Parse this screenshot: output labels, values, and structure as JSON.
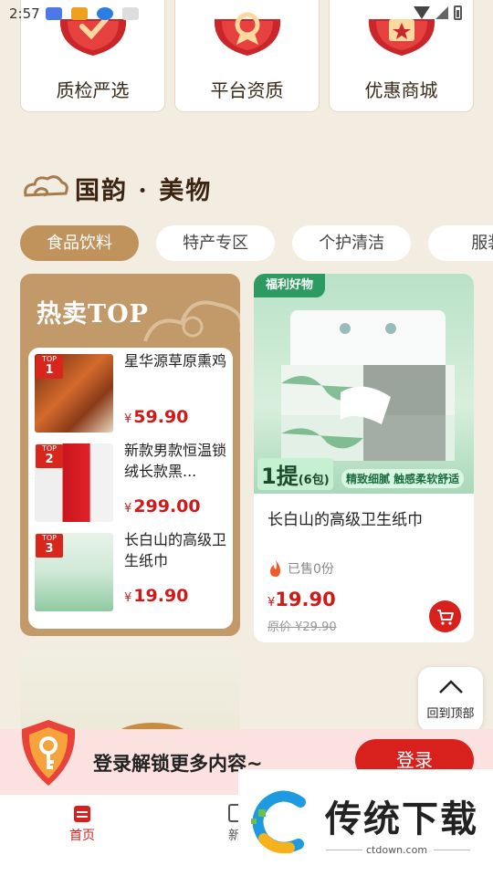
{
  "status_bar": {
    "time": "2:57"
  },
  "top_cards": [
    {
      "label": "质检严选",
      "icon": "quality-check-badge-icon"
    },
    {
      "label": "平台资质",
      "icon": "platform-qualification-badge-icon"
    },
    {
      "label": "优惠商城",
      "icon": "discount-mall-badge-icon"
    }
  ],
  "section": {
    "title": "国韵 · 美物"
  },
  "tabs": [
    {
      "label": "食品饮料",
      "active": true
    },
    {
      "label": "特产专区"
    },
    {
      "label": "个护清洁"
    },
    {
      "label": "服装"
    }
  ],
  "hot": {
    "title": "热卖TOP",
    "items": [
      {
        "rank_top": "TOP",
        "rank": "1",
        "name": "星华源草原熏鸡",
        "yen": "¥",
        "price": "59.90"
      },
      {
        "rank_top": "TOP",
        "rank": "2",
        "name": "新款男款恒温锁绒长款黑...",
        "yen": "¥",
        "price": "299.00"
      },
      {
        "rank_top": "TOP",
        "rank": "3",
        "name": "长白山的高级卫生纸巾",
        "yen": "¥",
        "price": "19.90"
      }
    ]
  },
  "product": {
    "tag": "福利好物",
    "pack_count": "1提",
    "pack_unit": "(6包)",
    "pack_slogan": "精致细腻 触感柔软舒适",
    "name": "长白山的高级卫生纸巾",
    "sold": "已售0份",
    "yen": "¥",
    "price": "19.90",
    "original_price": "原价 ¥29.90"
  },
  "back_to_top": {
    "label": "回到顶部"
  },
  "login_banner": {
    "text": "登录解锁更多内容~",
    "button": "登录"
  },
  "bottom_nav": {
    "home": "首页",
    "second": "新"
  },
  "watermark": {
    "text": "传统下载",
    "url": "ctdown.com"
  },
  "colors": {
    "accent_red": "#d8201c",
    "gold": "#c0935c",
    "background": "#f3ece1"
  }
}
